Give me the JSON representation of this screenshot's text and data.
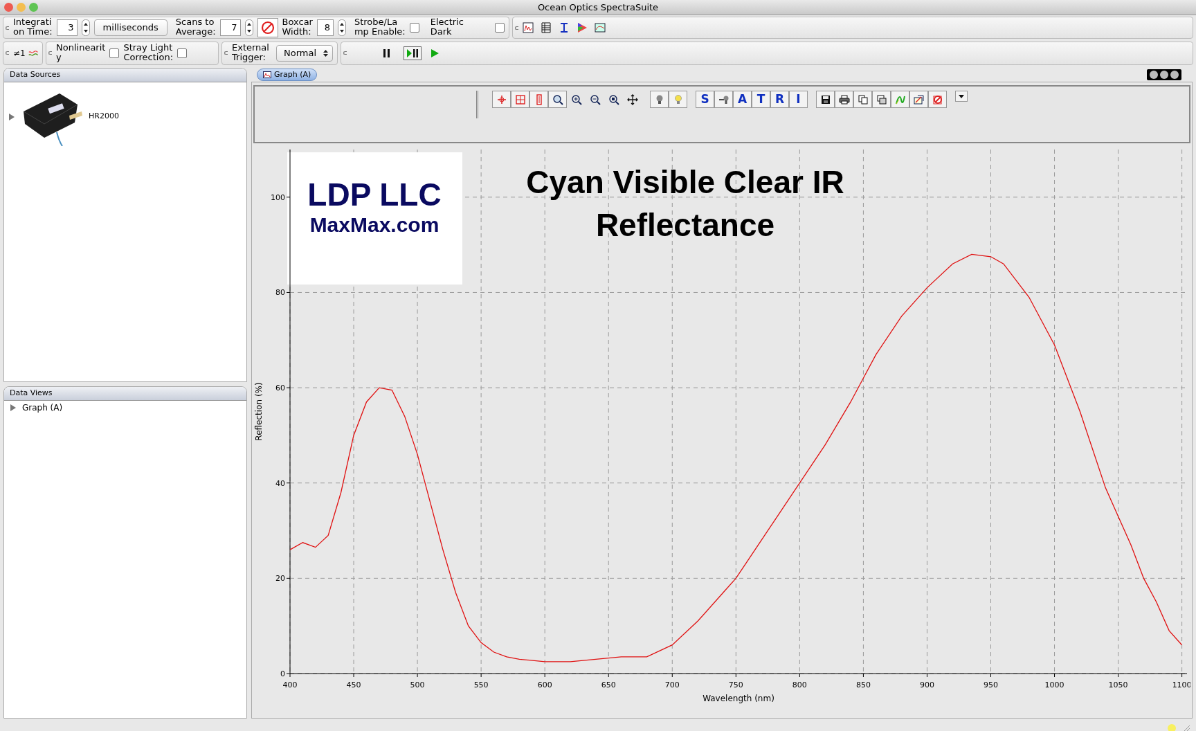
{
  "window": {
    "title": "Ocean Optics SpectraSuite"
  },
  "acquisition_toolbar": {
    "integration_time": {
      "label": [
        "Integrati",
        "on Time:"
      ],
      "value": "3",
      "unit": "milliseconds"
    },
    "scans_to_average": {
      "label": [
        "Scans to",
        "Average:"
      ],
      "value": "7"
    },
    "boxcar_width": {
      "label": [
        "Boxcar",
        "Width:"
      ],
      "value": "8"
    },
    "strobe_lamp_enable": {
      "label": [
        "Strobe/La",
        "mp Enable:"
      ],
      "checked": false
    },
    "electric_dark": {
      "label": [
        "Electric",
        "Dark"
      ],
      "checked": false
    }
  },
  "processing_toolbar": {
    "channel": "≠1",
    "nonlinearity": {
      "label": [
        "Nonlinearit",
        "y"
      ],
      "checked": false
    },
    "stray_light": {
      "label": [
        "Stray Light",
        "Correction:"
      ],
      "checked": false
    },
    "external_trigger": {
      "label": [
        "External",
        "Trigger:"
      ],
      "value": "Normal"
    }
  },
  "data_sources": {
    "title": "Data Sources",
    "items": [
      {
        "label": "HR2000",
        "expanded": false
      }
    ]
  },
  "data_views": {
    "title": "Data Views",
    "items": [
      {
        "label": "Graph (A)",
        "expanded": false
      }
    ]
  },
  "graph_tab": {
    "label": "Graph (A)",
    "selected": true
  },
  "graph_toolbar": [
    [
      {
        "kind": "crosshair"
      },
      {
        "kind": "zoom-box"
      },
      {
        "kind": "zoom-vertical"
      },
      {
        "kind": "zoom-fit"
      },
      {
        "kind": "zoom-in"
      },
      {
        "kind": "zoom-out"
      },
      {
        "kind": "zoom-reset"
      },
      {
        "kind": "pan"
      }
    ],
    [
      {
        "kind": "bulb-off"
      },
      {
        "kind": "bulb-on"
      }
    ],
    [
      {
        "kind": "letter",
        "text": "S"
      },
      {
        "kind": "probe"
      },
      {
        "kind": "letter",
        "text": "A"
      },
      {
        "kind": "letter",
        "text": "T"
      },
      {
        "kind": "letter",
        "text": "R"
      },
      {
        "kind": "letter",
        "text": "I"
      }
    ],
    [
      {
        "kind": "save"
      },
      {
        "kind": "print"
      },
      {
        "kind": "copy"
      },
      {
        "kind": "copy-window"
      },
      {
        "kind": "curve"
      },
      {
        "kind": "export"
      },
      {
        "kind": "remove"
      }
    ],
    [
      {
        "kind": "menu"
      }
    ]
  ],
  "graph": {
    "logo": [
      "LDP LLC",
      "MaxMax.com"
    ],
    "chart_data": {
      "type": "line",
      "title": "Cyan Visible Clear IR Reflectance",
      "xlabel": "Wavelength (nm)",
      "ylabel": "Reflection (%)",
      "xlim": [
        400,
        1104
      ],
      "ylim": [
        0,
        110
      ],
      "xticks": [
        400,
        450,
        500,
        550,
        600,
        650,
        700,
        750,
        800,
        850,
        900,
        950,
        1000,
        1050,
        1100
      ],
      "yticks": [
        0,
        20,
        40,
        60,
        80,
        100
      ],
      "x": [
        400,
        410,
        420,
        430,
        440,
        450,
        460,
        470,
        480,
        490,
        500,
        510,
        520,
        530,
        540,
        550,
        560,
        570,
        580,
        600,
        620,
        640,
        660,
        680,
        700,
        720,
        740,
        750,
        760,
        780,
        800,
        820,
        840,
        850,
        860,
        880,
        900,
        920,
        935,
        950,
        960,
        980,
        1000,
        1020,
        1040,
        1050,
        1060,
        1070,
        1080,
        1090,
        1100
      ],
      "grid": true,
      "series": [
        {
          "color": "#e01010",
          "values": [
            26,
            27.5,
            26.5,
            29,
            38,
            50,
            57,
            60,
            59.5,
            54,
            46,
            36,
            26,
            17,
            10,
            6.5,
            4.5,
            3.5,
            3,
            2.5,
            2.5,
            3,
            3.5,
            3.5,
            6,
            11,
            17,
            20,
            24,
            32,
            40,
            48,
            57,
            62,
            67,
            75,
            81,
            86,
            88,
            87.5,
            86,
            79,
            69,
            55,
            39,
            33,
            27,
            20,
            15,
            9,
            6
          ]
        }
      ]
    }
  }
}
